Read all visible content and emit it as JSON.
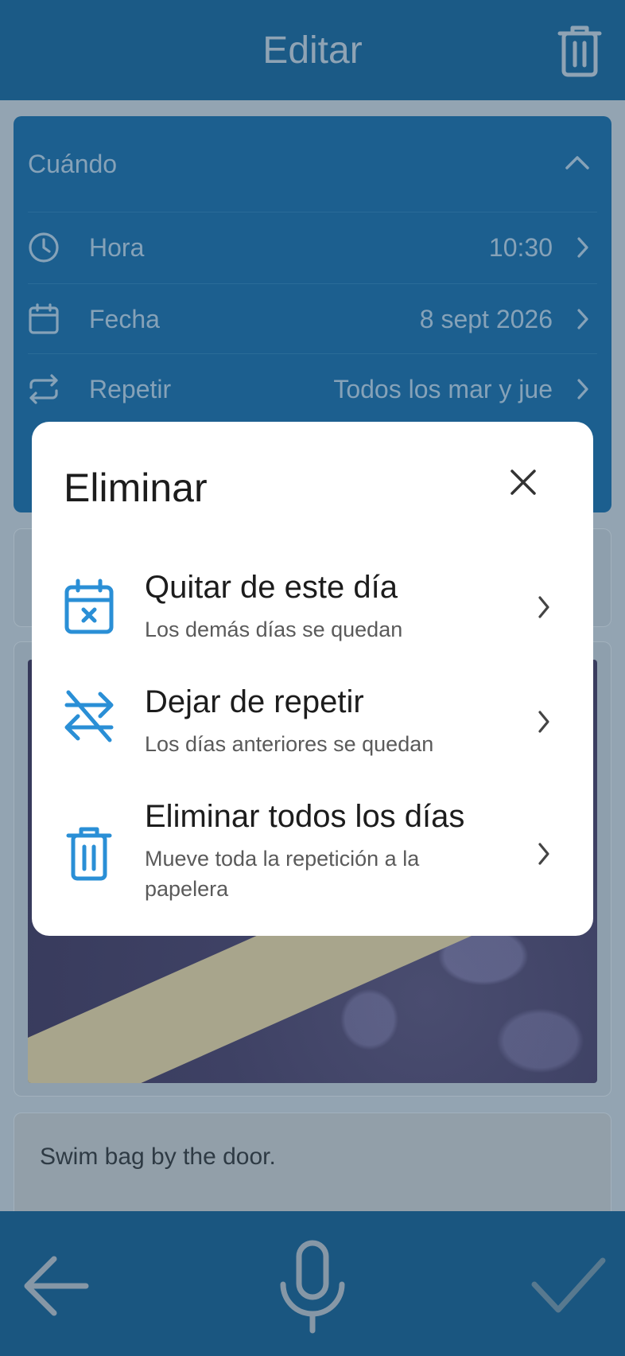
{
  "header": {
    "title": "Editar",
    "delete_icon": "trash-icon"
  },
  "when": {
    "label": "Cuándo",
    "rows": [
      {
        "label": "Hora",
        "value": "10:30",
        "icon": "clock-icon"
      },
      {
        "label": "Fecha",
        "value": "8 sept 2026",
        "icon": "calendar-icon"
      },
      {
        "label": "Repetir",
        "value": "Todos los mar y jue",
        "icon": "repeat-icon"
      }
    ]
  },
  "note": {
    "text": "Swim bag by the door."
  },
  "dialog": {
    "title": "Eliminar",
    "options": [
      {
        "title": "Quitar de este día",
        "subtitle": "Los demás días se quedan",
        "icon": "calendar-remove-icon"
      },
      {
        "title": "Dejar de repetir",
        "subtitle": "Los días anteriores se quedan",
        "icon": "repeat-off-icon"
      },
      {
        "title": "Eliminar todos los días",
        "subtitle": "Mueve toda la repetición a la papelera",
        "icon": "trash-icon"
      }
    ]
  },
  "bottom": {
    "back_icon": "arrow-left-icon",
    "mic_icon": "microphone-icon",
    "confirm_icon": "check-icon"
  },
  "colors": {
    "accent": "#2a8fd6",
    "topbar": "#1b5a86",
    "scrim": "#93a4b2"
  }
}
